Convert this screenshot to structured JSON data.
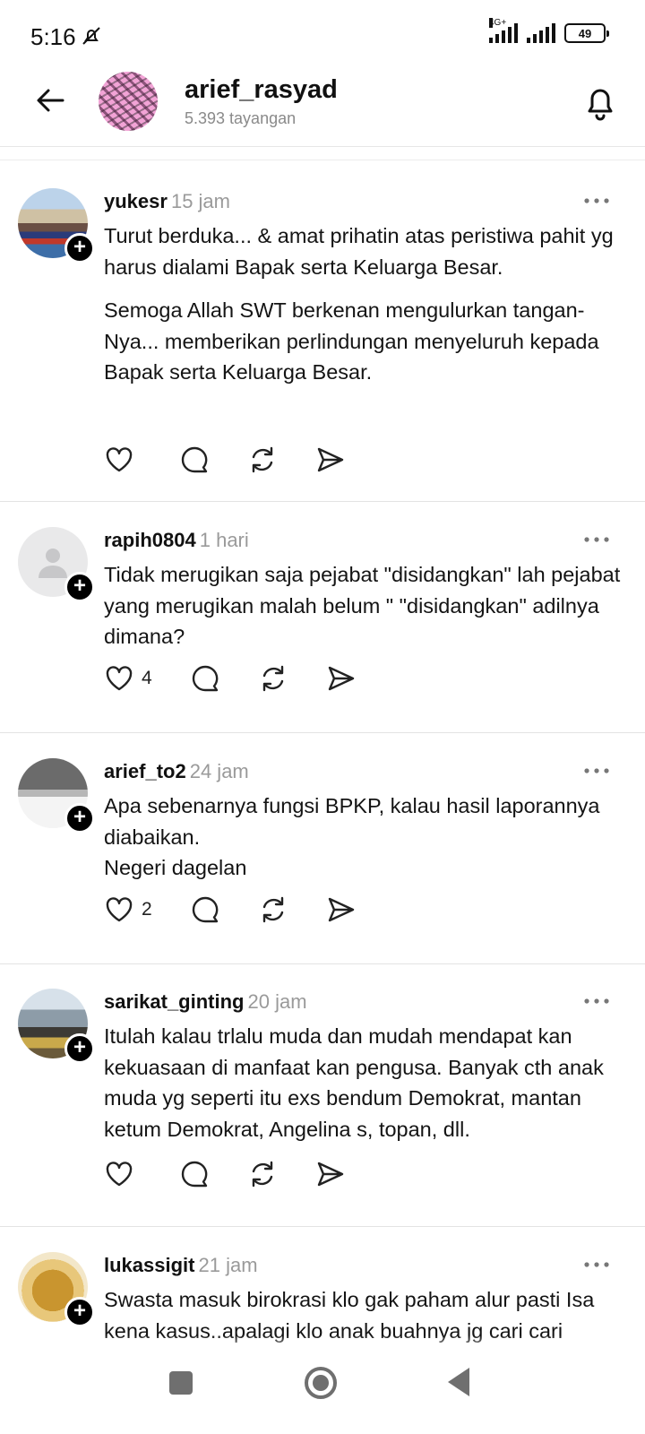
{
  "status": {
    "time": "5:16",
    "network": "4G+",
    "battery": "49"
  },
  "header": {
    "title": "arief_rasyad",
    "subtitle": "5.393 tayangan"
  },
  "comments": [
    {
      "username": "yukesr",
      "time": "15 jam",
      "paragraphs": [
        "Turut  berduka... &  amat  prihatin  atas  peristiwa  pahit  yg harus  dialami  Bapak  serta  Keluarga  Besar.",
        "Semoga  Allah  SWT  berkenan  mengulurkan  tangan-Nya... memberikan  perlindungan menyeluruh  kepada  Bapak  serta  Keluarga Besar."
      ],
      "likes": ""
    },
    {
      "username": "rapih0804",
      "time": "1 hari",
      "paragraphs": [
        "Tidak merugikan saja pejabat \"disidangkan\" lah pejabat yang merugikan malah belum \" \"disidangkan\" adilnya dimana?"
      ],
      "likes": "4"
    },
    {
      "username": "arief_to2",
      "time": "24 jam",
      "paragraphs": [
        "Apa sebenarnya fungsi BPKP, kalau hasil laporannya diabaikan.",
        "Negeri dagelan"
      ],
      "likes": "2"
    },
    {
      "username": "sarikat_ginting",
      "time": "20 jam",
      "paragraphs": [
        "Itulah kalau trlalu muda dan mudah mendapat kan kekuasaan di manfaat kan pengusa. Banyak cth anak muda yg seperti itu exs bendum Demokrat, mantan ketum Demokrat, Angelina s, topan, dll."
      ],
      "likes": ""
    },
    {
      "username": "lukassigit",
      "time": "21 jam",
      "paragraphs": [
        "Swasta masuk birokrasi klo gak paham alur pasti Isa kena kasus..apalagi klo anak buahnya jg cari cari"
      ],
      "likes": ""
    }
  ]
}
